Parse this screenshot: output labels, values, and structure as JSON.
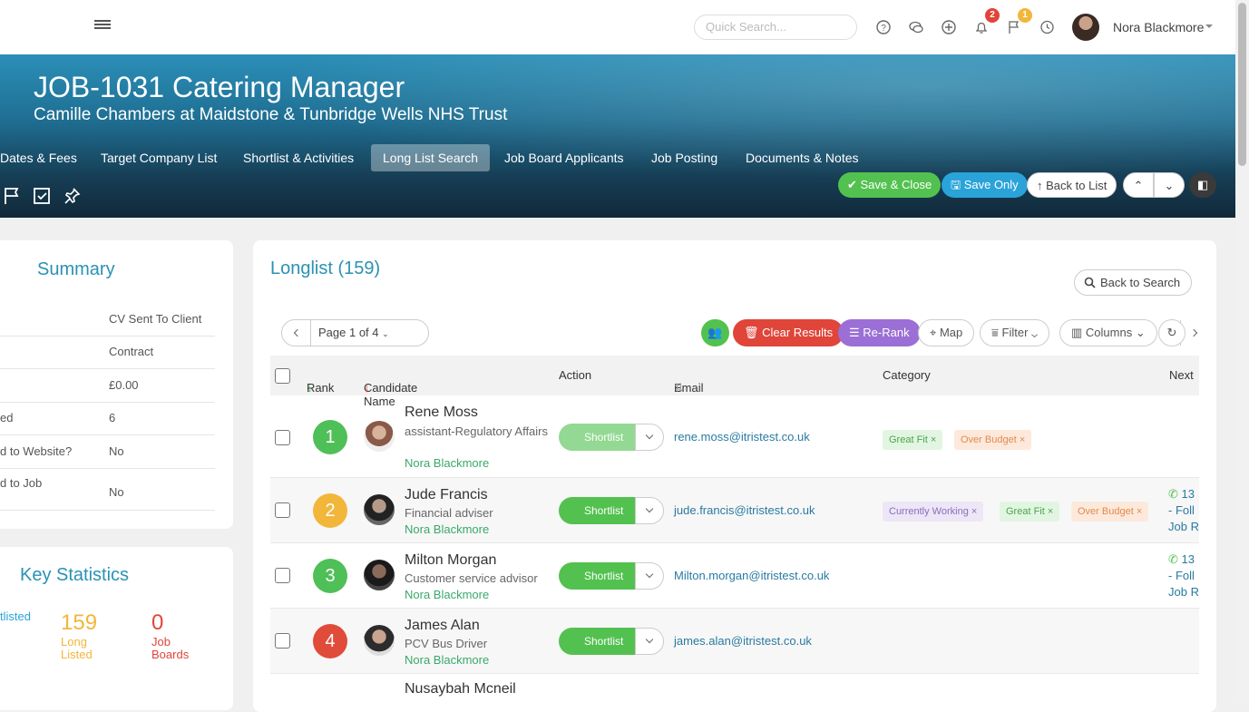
{
  "topbar": {
    "search_placeholder": "Quick Search...",
    "notif_count": "2",
    "flag_count": "1",
    "user_name": "Nora Blackmore"
  },
  "job": {
    "title": "JOB-1031 Catering Manager",
    "subtitle": "Camille Chambers at Maidstone & Tunbridge Wells NHS Trust"
  },
  "tabs": [
    {
      "label": "Dates & Fees"
    },
    {
      "label": "Target Company List"
    },
    {
      "label": "Shortlist & Activities"
    },
    {
      "label": "Long List Search"
    },
    {
      "label": "Job Board Applicants"
    },
    {
      "label": "Job Posting"
    },
    {
      "label": "Documents & Notes"
    }
  ],
  "actions": {
    "save_close": "Save & Close",
    "save_only": "Save Only",
    "back_to_list": "Back to List"
  },
  "summary": {
    "title": "Summary",
    "rows": [
      {
        "key": "",
        "value": "CV Sent To Client"
      },
      {
        "key": "",
        "value": "Contract"
      },
      {
        "key": "",
        "value": "£0.00"
      },
      {
        "key": "ed",
        "value": "6"
      },
      {
        "key": "d to Website?",
        "value": "No"
      },
      {
        "key": "d to Job",
        "value": "No"
      }
    ]
  },
  "stats": {
    "title": "Key Statistics",
    "items": [
      {
        "num": "",
        "label1": "tlisted",
        "label2": ""
      },
      {
        "num": "159",
        "label1": "Long",
        "label2": "Listed"
      },
      {
        "num": "0",
        "label1": "Job",
        "label2": "Boards"
      }
    ]
  },
  "longlist": {
    "title": "Longlist (159)",
    "back_search": "Back to Search",
    "page_label": "Page 1 of 4",
    "clear_results": "Clear Results",
    "rerank": "Re-Rank",
    "map": "Map",
    "filter": "Filter",
    "columns": "Columns"
  },
  "table": {
    "headers": {
      "rank": "Rank",
      "name": "Candidate Name",
      "action": "Action",
      "email": "Email",
      "category": "Category",
      "next": "Next"
    },
    "shortlist_label": "Shortlist",
    "rows": [
      {
        "rank": "1",
        "name": "Rene Moss",
        "role": "assistant-Regulatory Affairs",
        "owner": "Nora Blackmore",
        "email": "rene.moss@itristest.co.uk",
        "tags": [
          "Great Fit ×",
          "Over Budget ×"
        ],
        "next": ""
      },
      {
        "rank": "2",
        "name": "Jude Francis",
        "role": "Financial adviser",
        "owner": "Nora Blackmore",
        "email": "jude.francis@itristest.co.uk",
        "tags": [
          "Currently Working ×",
          "Great Fit ×",
          "Over Budget ×"
        ],
        "next1": "13",
        "next2": "- Foll",
        "next3": "Job R"
      },
      {
        "rank": "3",
        "name": "Milton Morgan",
        "role": "Customer service advisor",
        "owner": "Nora Blackmore",
        "email": "Milton.morgan@itristest.co.uk",
        "tags": [],
        "next1": "13",
        "next2": "- Foll",
        "next3": "Job R"
      },
      {
        "rank": "4",
        "name": "James Alan",
        "role": "PCV Bus Driver",
        "owner": "Nora Blackmore",
        "email": "james.alan@itristest.co.uk",
        "tags": [],
        "next": ""
      },
      {
        "rank": "",
        "name": "Nusaybah Mcneil",
        "role": "",
        "owner": "",
        "email": "",
        "tags": []
      }
    ]
  },
  "colors": {
    "accent": "#2a92b3",
    "green": "#53c14f",
    "rank_green": "#4fbf58",
    "rank_orange": "#f2b63a",
    "rank_red": "#e04b3a",
    "red_btn": "#e0453a",
    "purple_btn": "#9b6fd6"
  }
}
